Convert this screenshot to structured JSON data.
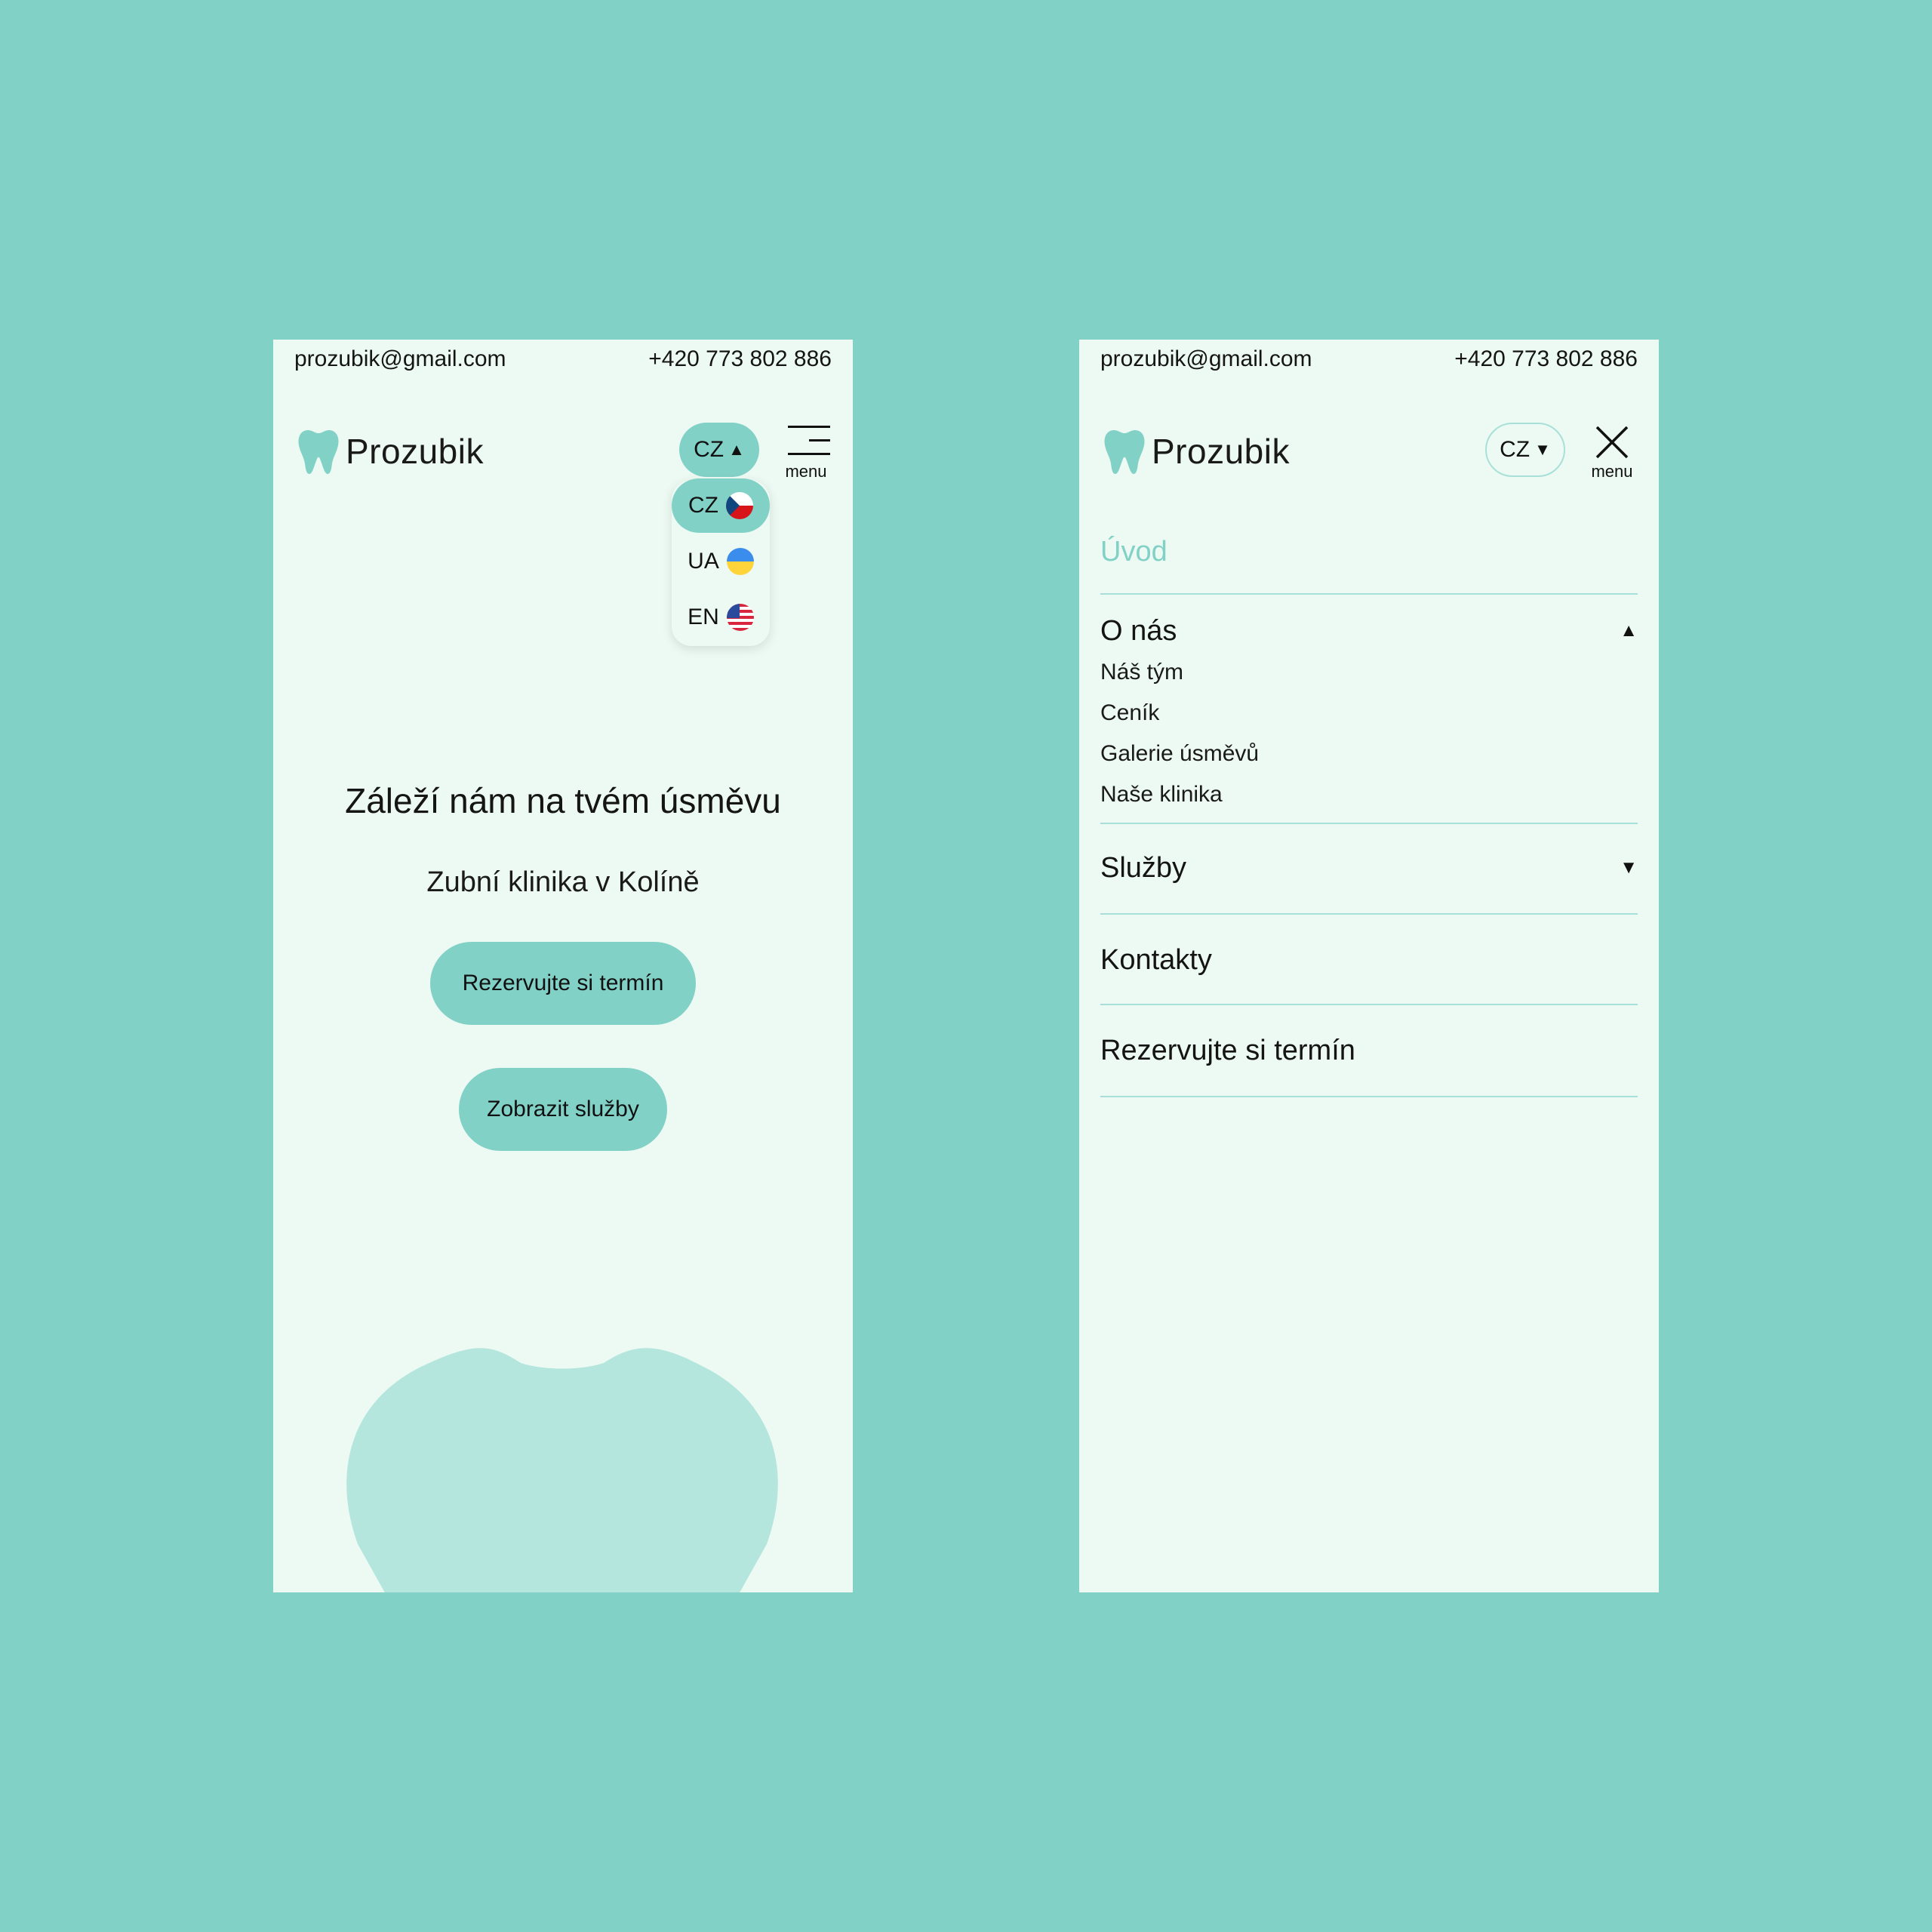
{
  "colors": {
    "background": "#82d1c7",
    "screen": "#edfaf3",
    "accent": "#82d1c7",
    "tooth_shape": "#b4e6dd",
    "divider": "#a7e0d8"
  },
  "contact": {
    "email": "prozubik@gmail.com",
    "phone": "+420 773 802 886"
  },
  "brand": {
    "name": "Prozubik",
    "logo_icon": "tooth-icon"
  },
  "header": {
    "menu_label": "menu",
    "left_lang": {
      "value": "CZ",
      "caret": "▲"
    },
    "right_lang": {
      "value": "CZ",
      "caret": "▼"
    },
    "menu_icon": "hamburger-icon",
    "close_icon": "close-icon"
  },
  "lang_dropdown": {
    "options": [
      {
        "code": "CZ",
        "flag": "czech-flag-icon",
        "active": true
      },
      {
        "code": "UA",
        "flag": "ukraine-flag-icon",
        "active": false
      },
      {
        "code": "EN",
        "flag": "us-flag-icon",
        "active": false
      }
    ]
  },
  "hero": {
    "title": "Záleží nám na tvém úsměvu",
    "subtitle": "Zubní klinika v Kolíně",
    "book_button": "Rezervujte si termín",
    "services_button": "Zobrazit služby"
  },
  "nav": {
    "items": [
      {
        "label": "Úvod",
        "active": true
      },
      {
        "label": "O nás",
        "caret": "▲",
        "expanded": true,
        "children": [
          "Náš tým",
          "Ceník",
          "Galerie úsměvů",
          "Naše klinika"
        ]
      },
      {
        "label": "Služby",
        "caret": "▼",
        "expanded": false
      },
      {
        "label": "Kontakty"
      },
      {
        "label": "Rezervujte si termín"
      }
    ]
  }
}
